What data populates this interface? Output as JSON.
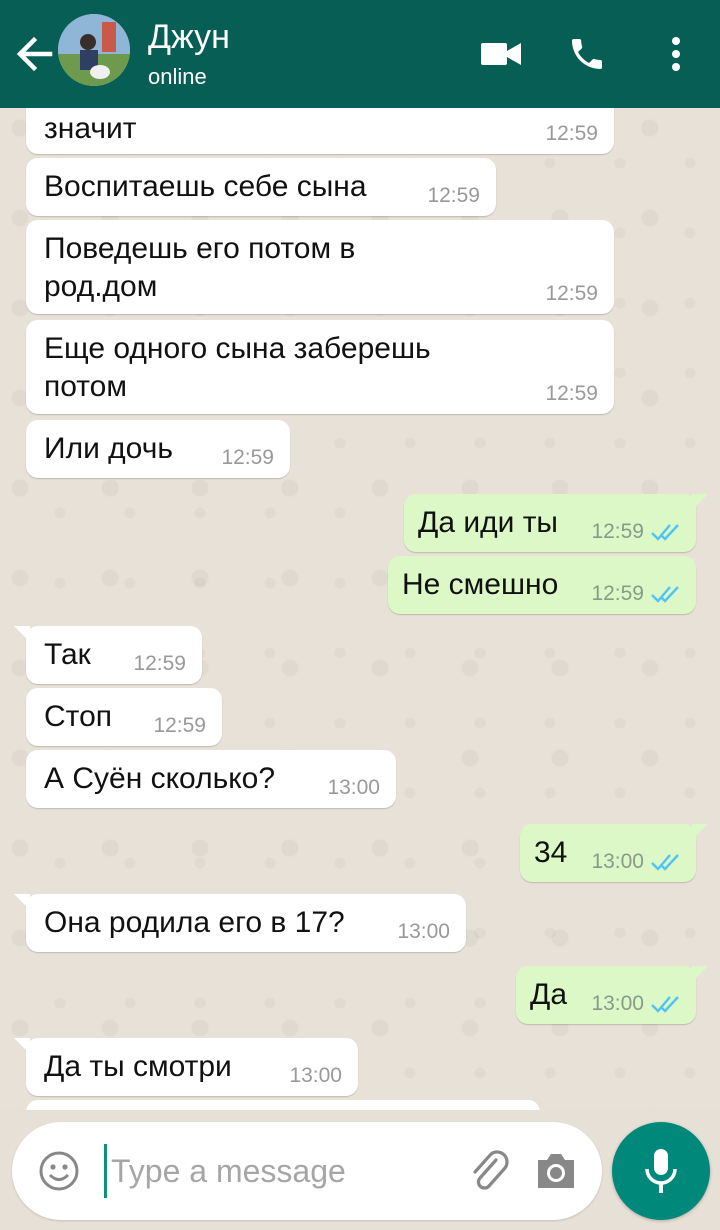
{
  "header": {
    "contact_name": "Джун",
    "status": "online",
    "bg_color": "#075e54"
  },
  "messages": [
    {
      "dir": "in",
      "text": "значит",
      "time": "12:59"
    },
    {
      "dir": "in",
      "text": "Воспитаешь себе сына",
      "time": "12:59"
    },
    {
      "dir": "in",
      "text": "Поведешь его потом в\nрод.дом",
      "time": "12:59"
    },
    {
      "dir": "in",
      "text": "Еще одного сына заберешь\nпотом",
      "time": "12:59"
    },
    {
      "dir": "in",
      "text": "Или дочь",
      "time": "12:59"
    },
    {
      "dir": "out",
      "text": "Да иди ты",
      "time": "12:59",
      "status": "read"
    },
    {
      "dir": "out",
      "text": "Не смешно",
      "time": "12:59",
      "status": "read"
    },
    {
      "dir": "in",
      "text": "Так",
      "time": "12:59"
    },
    {
      "dir": "in",
      "text": "Стоп",
      "time": "12:59"
    },
    {
      "dir": "in",
      "text": "А Суён сколько?",
      "time": "13:00"
    },
    {
      "dir": "out",
      "text": "34",
      "time": "13:00",
      "status": "read"
    },
    {
      "dir": "in",
      "text": "Она родила его в 17?",
      "time": "13:00"
    },
    {
      "dir": "out",
      "text": "Да",
      "time": "13:00",
      "status": "read"
    },
    {
      "dir": "in",
      "text": "Да ты смотри",
      "time": "13:00"
    }
  ],
  "composer": {
    "placeholder": "Type a message",
    "value": ""
  },
  "colors": {
    "incoming_bubble": "#ffffff",
    "outgoing_bubble": "#dcf8c6",
    "read_ticks": "#4fc3f7",
    "mic_button": "#00897b"
  }
}
